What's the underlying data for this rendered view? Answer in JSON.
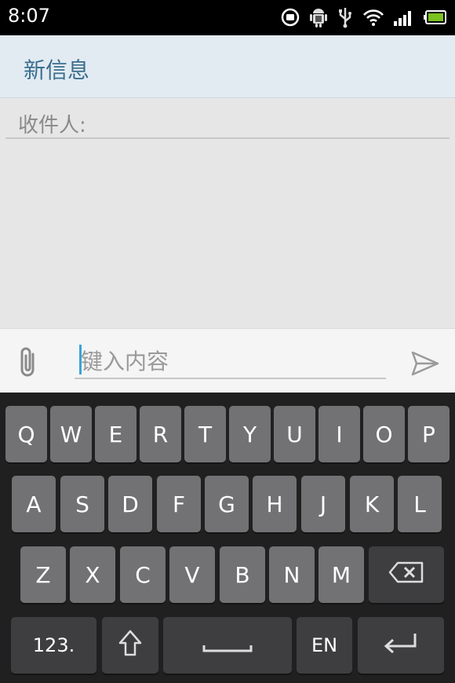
{
  "status_bar": {
    "time": "8:07",
    "icons": [
      "m-circle-icon",
      "android-debug-icon",
      "usb-icon",
      "wifi-icon",
      "signal-icon",
      "battery-icon"
    ]
  },
  "header": {
    "title": "新信息"
  },
  "recipients": {
    "label": "收件人:"
  },
  "compose": {
    "placeholder": "键入内容",
    "value": ""
  },
  "keyboard": {
    "row1": [
      "Q",
      "W",
      "E",
      "R",
      "T",
      "Y",
      "U",
      "I",
      "O",
      "P"
    ],
    "row2": [
      "A",
      "S",
      "D",
      "F",
      "G",
      "H",
      "J",
      "K",
      "L"
    ],
    "row3": [
      "Z",
      "X",
      "C",
      "V",
      "B",
      "N",
      "M"
    ],
    "numbers_label": "123.",
    "language_label": "EN"
  },
  "colors": {
    "status_bar_bg": "#000000",
    "header_bg": "#e2ebf2",
    "header_title": "#3a6e8e",
    "cursor_accent": "#3aa3d8",
    "keyboard_bg": "#202020",
    "key_bg": "#727274",
    "key_dark_bg": "#3e3e40"
  }
}
